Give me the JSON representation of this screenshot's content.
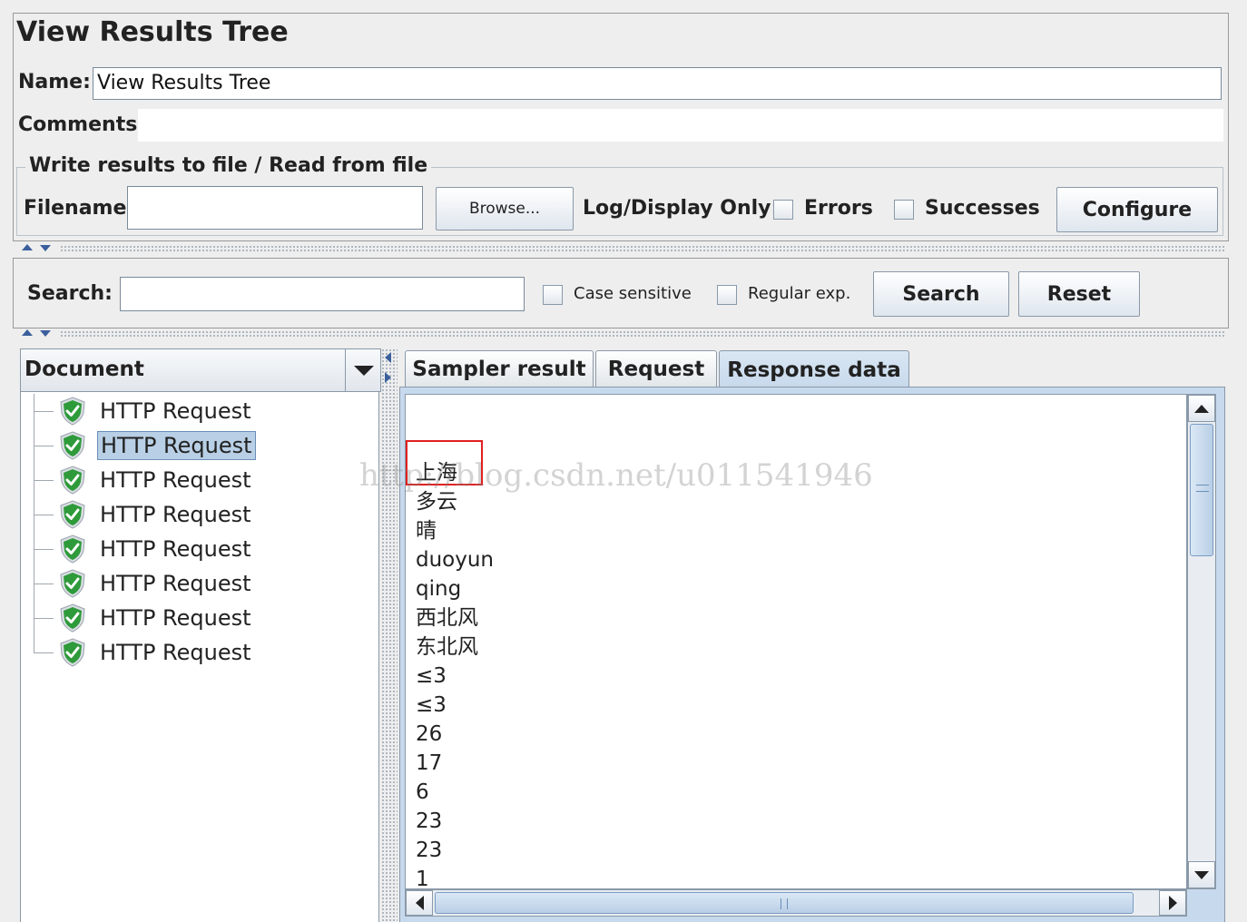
{
  "panel_title": "View Results Tree",
  "name_label": "Name:",
  "name_value": "View Results Tree",
  "comments_label": "Comments:",
  "file_group": {
    "title": "Write results to file / Read from file",
    "filename_label": "Filename",
    "filename_value": "",
    "browse_label": "Browse...",
    "log_display_label": "Log/Display Only:",
    "errors_label": "Errors",
    "successes_label": "Successes",
    "configure_label": "Configure"
  },
  "search": {
    "label": "Search:",
    "value": "",
    "case_sensitive_label": "Case sensitive",
    "regex_label": "Regular exp.",
    "search_button": "Search",
    "reset_button": "Reset"
  },
  "renderer": {
    "selected": "Document"
  },
  "tree": {
    "items": [
      {
        "label": "HTTP Request",
        "selected": false
      },
      {
        "label": "HTTP Request",
        "selected": true
      },
      {
        "label": "HTTP Request",
        "selected": false
      },
      {
        "label": "HTTP Request",
        "selected": false
      },
      {
        "label": "HTTP Request",
        "selected": false
      },
      {
        "label": "HTTP Request",
        "selected": false
      },
      {
        "label": "HTTP Request",
        "selected": false
      },
      {
        "label": "HTTP Request",
        "selected": false
      }
    ]
  },
  "tabs": [
    {
      "label": "Sampler result",
      "active": false
    },
    {
      "label": "Request",
      "active": false
    },
    {
      "label": "Response data",
      "active": true
    }
  ],
  "response_lines": [
    "上海",
    "多云",
    "晴",
    "duoyun",
    "qing",
    "西北风",
    "东北风",
    "≤3",
    "≤3",
    "26",
    "17",
    "6",
    "23",
    "23",
    "1"
  ],
  "watermark": "http://blog.csdn.net/u011541946",
  "colors": {
    "highlight_box": "#e02020",
    "success_icon": "#2e9a3a",
    "selection": "#b8cfe5"
  }
}
